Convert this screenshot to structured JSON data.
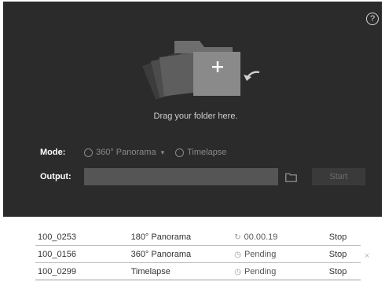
{
  "help": {
    "icon": "help-icon",
    "glyph": "?"
  },
  "drop": {
    "text": "Drag your folder here.",
    "plus": "+",
    "icons": [
      "folder-stack-icon",
      "plus-icon",
      "drop-arrow-icon"
    ]
  },
  "mode": {
    "label": "Mode:",
    "options": [
      {
        "label": "360° Panorama",
        "caret": "▾"
      },
      {
        "label": "Timelapse"
      }
    ]
  },
  "output": {
    "label": "Output:",
    "value": "",
    "browse_icon": "folder-icon",
    "start_label": "Start"
  },
  "queue": {
    "rows": [
      {
        "id": "100_0253",
        "type": "180° Panorama",
        "status_icon": "spinner-icon",
        "status_glyph": "↻",
        "status": "00.00.19",
        "action": "Stop"
      },
      {
        "id": "100_0156",
        "type": "360° Panorama",
        "status_icon": "clock-icon",
        "status_glyph": "◷",
        "status": "Pending",
        "action": "Stop"
      },
      {
        "id": "100_0299",
        "type": "Timelapse",
        "status_icon": "clock-icon",
        "status_glyph": "◷",
        "status": "Pending",
        "action": "Stop"
      }
    ],
    "remove_glyph": "×"
  },
  "colors": {
    "panel": "#2b2b2b",
    "folder": "#8a8a8a",
    "field": "#555555"
  }
}
